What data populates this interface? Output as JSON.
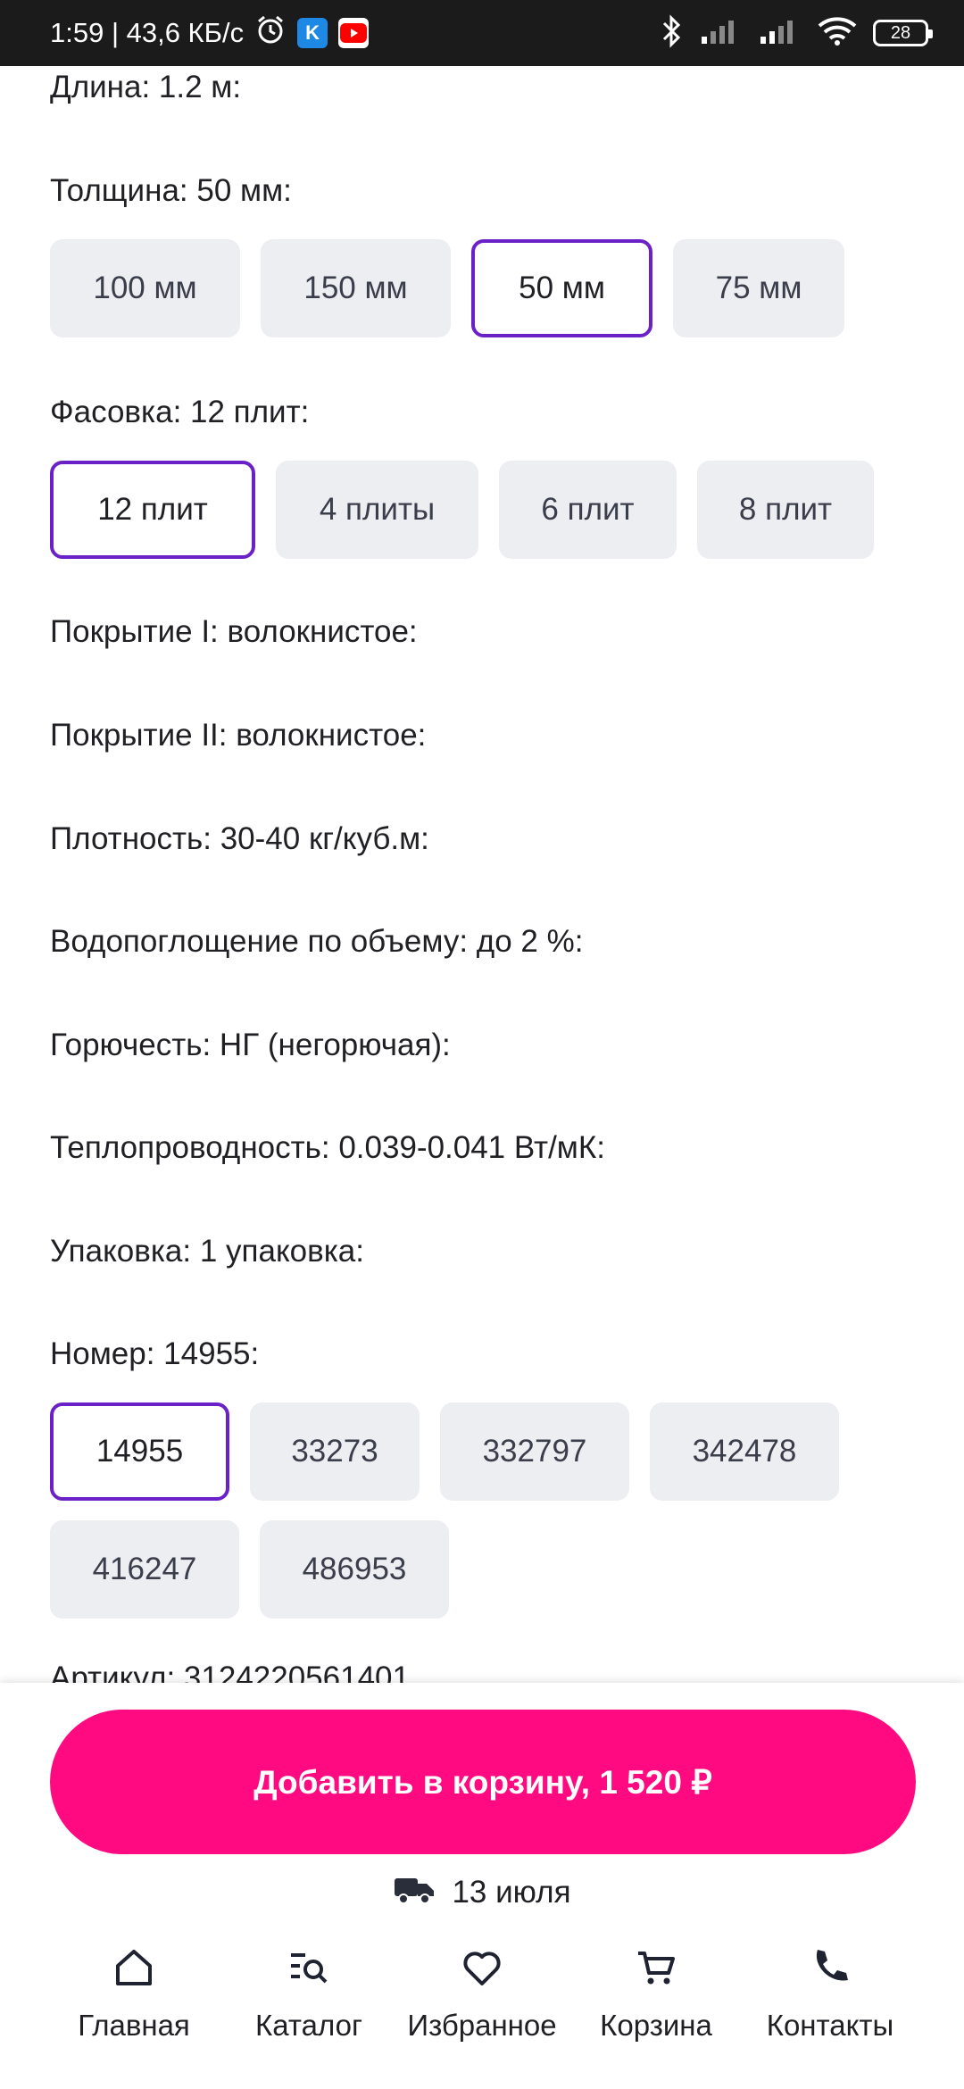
{
  "status_bar": {
    "time_speed": "1:59 | 43,6 КБ/с",
    "k_badge": "K",
    "battery": "28",
    "colors": {
      "k_badge": "#1e88e5",
      "yt_badge": "#ff0000"
    }
  },
  "attributes": {
    "length": "Длина: 1.2 м:",
    "thickness": "Толщина: 50 мм:",
    "packing": "Фасовка: 12 плит:",
    "coating1": "Покрытие I: волокнистое:",
    "coating2": "Покрытие II: волокнистое:",
    "density": "Плотность: 30-40 кг/куб.м:",
    "water": "Водопоглощение по объему: до 2 %:",
    "flammability": "Горючесть: НГ (негорючая):",
    "thermal": "Теплопроводность: 0.039-0.041 Вт/мК:",
    "package": "Упаковка: 1 упаковка:",
    "number": "Номер: 14955:",
    "article_cut": "Артикул: 3124220561401"
  },
  "thickness_options": [
    "100 мм",
    "150 мм",
    "50 мм",
    "75 мм"
  ],
  "packing_options": [
    "12 плит",
    "4 плиты",
    "6 плит",
    "8 плит"
  ],
  "number_options_row1": [
    "14955",
    "33273",
    "332797",
    "342478"
  ],
  "number_options_row2": [
    "416247",
    "486953"
  ],
  "cart": {
    "add_button": "Добавить в корзину, 1 520 ₽",
    "delivery_date": "13 июля",
    "accent_color": "#ff0a80",
    "selected_border_color": "#6b21c8"
  },
  "nav": {
    "home": "Главная",
    "catalog": "Каталог",
    "favorites": "Избранное",
    "cart": "Корзина",
    "contacts": "Контакты"
  }
}
